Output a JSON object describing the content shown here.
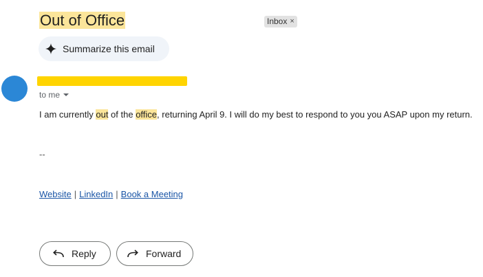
{
  "email": {
    "subject": "Out of Office",
    "label_chip": "Inbox",
    "label_chip_close": "×",
    "summarize_label": "Summarize this email",
    "sender": {
      "redacted": true,
      "avatar_color": "#2b87d6"
    },
    "recipient": "to me",
    "body": {
      "part1": "I am currently ",
      "hl1": "out",
      "part2": " of the ",
      "hl2": "office",
      "part3": ", returning April 9. I will do my best to respond to you you ASAP upon my return."
    },
    "signature_dash": "--",
    "links": {
      "website": "Website",
      "linkedin": "LinkedIn",
      "book_meeting": "Book a Meeting",
      "separator": "|"
    },
    "actions": {
      "reply": "Reply",
      "forward": "Forward"
    }
  },
  "colors": {
    "highlight": "#fbe59a",
    "link": "#1a55a6",
    "redaction": "#ffd400"
  },
  "icons": [
    "sparkle-icon",
    "reply-icon",
    "forward-icon",
    "chevron-down-icon",
    "close-icon"
  ]
}
